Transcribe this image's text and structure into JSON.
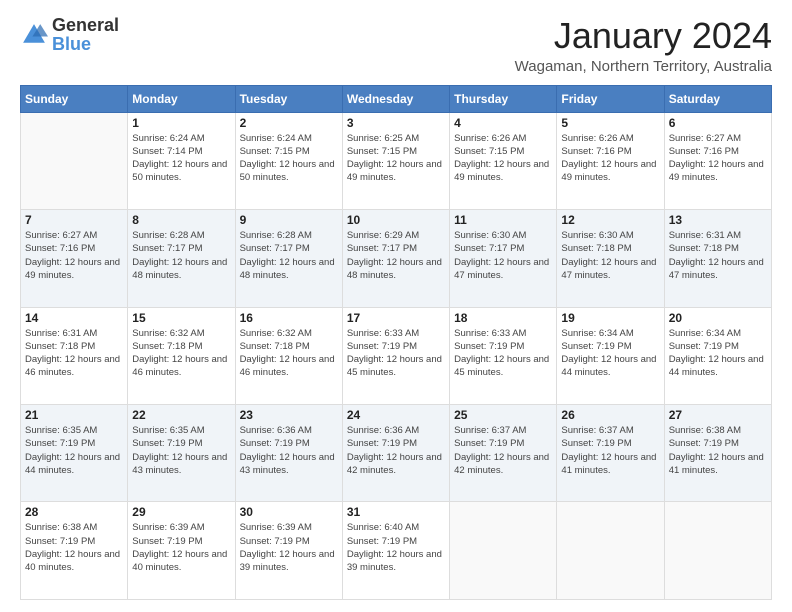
{
  "logo": {
    "general": "General",
    "blue": "Blue"
  },
  "header": {
    "month": "January 2024",
    "location": "Wagaman, Northern Territory, Australia"
  },
  "days_of_week": [
    "Sunday",
    "Monday",
    "Tuesday",
    "Wednesday",
    "Thursday",
    "Friday",
    "Saturday"
  ],
  "weeks": [
    [
      {
        "day": "",
        "sunrise": "",
        "sunset": "",
        "daylight": ""
      },
      {
        "day": "1",
        "sunrise": "Sunrise: 6:24 AM",
        "sunset": "Sunset: 7:14 PM",
        "daylight": "Daylight: 12 hours and 50 minutes."
      },
      {
        "day": "2",
        "sunrise": "Sunrise: 6:24 AM",
        "sunset": "Sunset: 7:15 PM",
        "daylight": "Daylight: 12 hours and 50 minutes."
      },
      {
        "day": "3",
        "sunrise": "Sunrise: 6:25 AM",
        "sunset": "Sunset: 7:15 PM",
        "daylight": "Daylight: 12 hours and 49 minutes."
      },
      {
        "day": "4",
        "sunrise": "Sunrise: 6:26 AM",
        "sunset": "Sunset: 7:15 PM",
        "daylight": "Daylight: 12 hours and 49 minutes."
      },
      {
        "day": "5",
        "sunrise": "Sunrise: 6:26 AM",
        "sunset": "Sunset: 7:16 PM",
        "daylight": "Daylight: 12 hours and 49 minutes."
      },
      {
        "day": "6",
        "sunrise": "Sunrise: 6:27 AM",
        "sunset": "Sunset: 7:16 PM",
        "daylight": "Daylight: 12 hours and 49 minutes."
      }
    ],
    [
      {
        "day": "7",
        "sunrise": "Sunrise: 6:27 AM",
        "sunset": "Sunset: 7:16 PM",
        "daylight": "Daylight: 12 hours and 49 minutes."
      },
      {
        "day": "8",
        "sunrise": "Sunrise: 6:28 AM",
        "sunset": "Sunset: 7:17 PM",
        "daylight": "Daylight: 12 hours and 48 minutes."
      },
      {
        "day": "9",
        "sunrise": "Sunrise: 6:28 AM",
        "sunset": "Sunset: 7:17 PM",
        "daylight": "Daylight: 12 hours and 48 minutes."
      },
      {
        "day": "10",
        "sunrise": "Sunrise: 6:29 AM",
        "sunset": "Sunset: 7:17 PM",
        "daylight": "Daylight: 12 hours and 48 minutes."
      },
      {
        "day": "11",
        "sunrise": "Sunrise: 6:30 AM",
        "sunset": "Sunset: 7:17 PM",
        "daylight": "Daylight: 12 hours and 47 minutes."
      },
      {
        "day": "12",
        "sunrise": "Sunrise: 6:30 AM",
        "sunset": "Sunset: 7:18 PM",
        "daylight": "Daylight: 12 hours and 47 minutes."
      },
      {
        "day": "13",
        "sunrise": "Sunrise: 6:31 AM",
        "sunset": "Sunset: 7:18 PM",
        "daylight": "Daylight: 12 hours and 47 minutes."
      }
    ],
    [
      {
        "day": "14",
        "sunrise": "Sunrise: 6:31 AM",
        "sunset": "Sunset: 7:18 PM",
        "daylight": "Daylight: 12 hours and 46 minutes."
      },
      {
        "day": "15",
        "sunrise": "Sunrise: 6:32 AM",
        "sunset": "Sunset: 7:18 PM",
        "daylight": "Daylight: 12 hours and 46 minutes."
      },
      {
        "day": "16",
        "sunrise": "Sunrise: 6:32 AM",
        "sunset": "Sunset: 7:18 PM",
        "daylight": "Daylight: 12 hours and 46 minutes."
      },
      {
        "day": "17",
        "sunrise": "Sunrise: 6:33 AM",
        "sunset": "Sunset: 7:19 PM",
        "daylight": "Daylight: 12 hours and 45 minutes."
      },
      {
        "day": "18",
        "sunrise": "Sunrise: 6:33 AM",
        "sunset": "Sunset: 7:19 PM",
        "daylight": "Daylight: 12 hours and 45 minutes."
      },
      {
        "day": "19",
        "sunrise": "Sunrise: 6:34 AM",
        "sunset": "Sunset: 7:19 PM",
        "daylight": "Daylight: 12 hours and 44 minutes."
      },
      {
        "day": "20",
        "sunrise": "Sunrise: 6:34 AM",
        "sunset": "Sunset: 7:19 PM",
        "daylight": "Daylight: 12 hours and 44 minutes."
      }
    ],
    [
      {
        "day": "21",
        "sunrise": "Sunrise: 6:35 AM",
        "sunset": "Sunset: 7:19 PM",
        "daylight": "Daylight: 12 hours and 44 minutes."
      },
      {
        "day": "22",
        "sunrise": "Sunrise: 6:35 AM",
        "sunset": "Sunset: 7:19 PM",
        "daylight": "Daylight: 12 hours and 43 minutes."
      },
      {
        "day": "23",
        "sunrise": "Sunrise: 6:36 AM",
        "sunset": "Sunset: 7:19 PM",
        "daylight": "Daylight: 12 hours and 43 minutes."
      },
      {
        "day": "24",
        "sunrise": "Sunrise: 6:36 AM",
        "sunset": "Sunset: 7:19 PM",
        "daylight": "Daylight: 12 hours and 42 minutes."
      },
      {
        "day": "25",
        "sunrise": "Sunrise: 6:37 AM",
        "sunset": "Sunset: 7:19 PM",
        "daylight": "Daylight: 12 hours and 42 minutes."
      },
      {
        "day": "26",
        "sunrise": "Sunrise: 6:37 AM",
        "sunset": "Sunset: 7:19 PM",
        "daylight": "Daylight: 12 hours and 41 minutes."
      },
      {
        "day": "27",
        "sunrise": "Sunrise: 6:38 AM",
        "sunset": "Sunset: 7:19 PM",
        "daylight": "Daylight: 12 hours and 41 minutes."
      }
    ],
    [
      {
        "day": "28",
        "sunrise": "Sunrise: 6:38 AM",
        "sunset": "Sunset: 7:19 PM",
        "daylight": "Daylight: 12 hours and 40 minutes."
      },
      {
        "day": "29",
        "sunrise": "Sunrise: 6:39 AM",
        "sunset": "Sunset: 7:19 PM",
        "daylight": "Daylight: 12 hours and 40 minutes."
      },
      {
        "day": "30",
        "sunrise": "Sunrise: 6:39 AM",
        "sunset": "Sunset: 7:19 PM",
        "daylight": "Daylight: 12 hours and 39 minutes."
      },
      {
        "day": "31",
        "sunrise": "Sunrise: 6:40 AM",
        "sunset": "Sunset: 7:19 PM",
        "daylight": "Daylight: 12 hours and 39 minutes."
      },
      {
        "day": "",
        "sunrise": "",
        "sunset": "",
        "daylight": ""
      },
      {
        "day": "",
        "sunrise": "",
        "sunset": "",
        "daylight": ""
      },
      {
        "day": "",
        "sunrise": "",
        "sunset": "",
        "daylight": ""
      }
    ]
  ]
}
